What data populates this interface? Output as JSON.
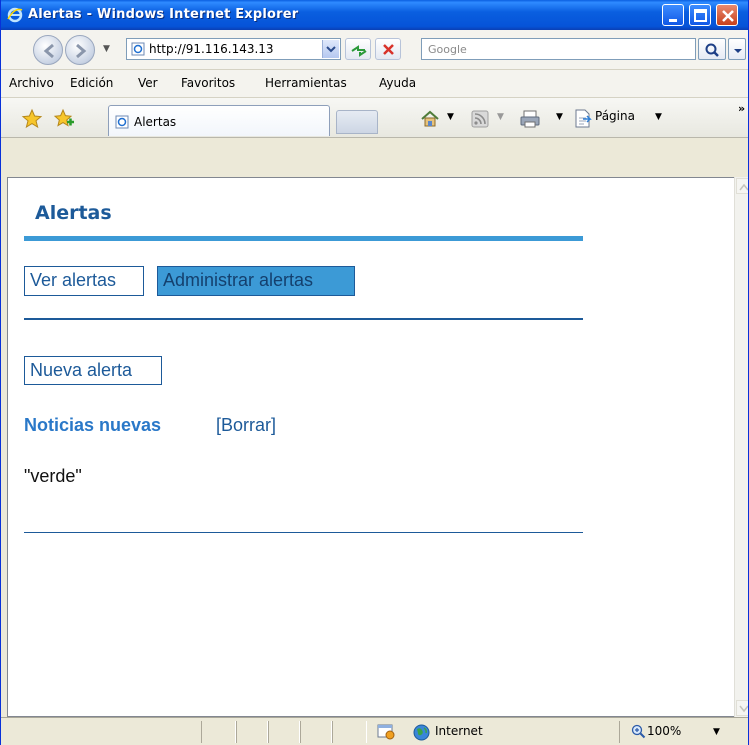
{
  "window": {
    "title": "Alertas - Windows Internet Explorer"
  },
  "address_bar": {
    "url": "http://91.116.143.13",
    "search_placeholder": "Google"
  },
  "menu": {
    "items": [
      "Archivo",
      "Edición",
      "Ver",
      "Favoritos",
      "Herramientas",
      "Ayuda"
    ]
  },
  "tabs": {
    "active_label": "Alertas"
  },
  "toolbar": {
    "page_label": "Página"
  },
  "page": {
    "title": "Alertas",
    "tab_view": "Ver alertas",
    "tab_manage": "Administrar alertas",
    "new_alert": "Nueva alerta",
    "section_title": "Noticias nuevas",
    "delete_link": "[Borrar]",
    "alert_item": "\"verde\""
  },
  "status": {
    "zone": "Internet",
    "zoom": "100%"
  },
  "colors": {
    "accent_dark": "#1d5a99",
    "accent_light": "#3c9ad6",
    "link": "#2a78c8"
  },
  "icons": [
    "ie-logo-icon",
    "back-arrow-icon",
    "forward-arrow-icon",
    "page-icon",
    "refresh-icon",
    "stop-icon",
    "search-icon",
    "favorites-star-icon",
    "add-favorites-icon",
    "home-icon",
    "feeds-icon",
    "print-icon",
    "page-menu-icon",
    "globe-icon",
    "zoom-icon"
  ]
}
